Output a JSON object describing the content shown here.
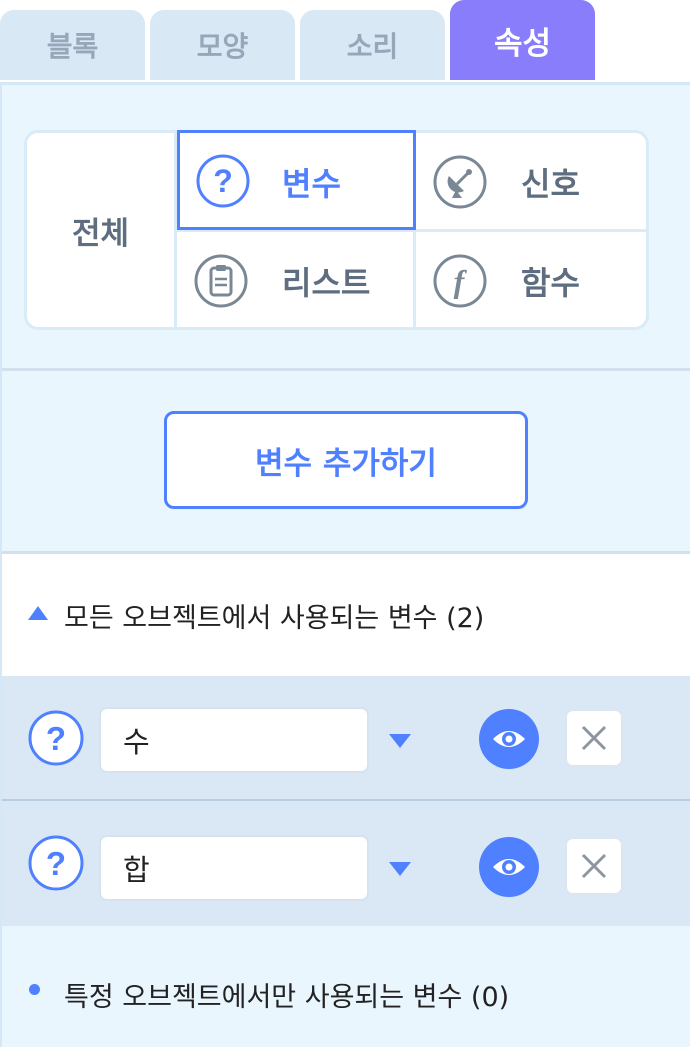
{
  "tabs": [
    {
      "label": "블록",
      "active": false
    },
    {
      "label": "모양",
      "active": false
    },
    {
      "label": "소리",
      "active": false
    },
    {
      "label": "속성",
      "active": true
    }
  ],
  "filter": {
    "all_label": "전체",
    "items": [
      {
        "label": "변수",
        "icon": "question-icon",
        "selected": true
      },
      {
        "label": "신호",
        "icon": "signal-dish-icon",
        "selected": false
      },
      {
        "label": "리스트",
        "icon": "clipboard-list-icon",
        "selected": false
      },
      {
        "label": "함수",
        "icon": "function-icon",
        "selected": false
      }
    ]
  },
  "add_button_label": "변수 추가하기",
  "global_section": {
    "title": "모든 오브젝트에서 사용되는 변수 (2)",
    "variables": [
      {
        "name": "수"
      },
      {
        "name": "합"
      }
    ]
  },
  "local_section": {
    "title": "특정 오브젝트에서만 사용되는 변수 (0)"
  },
  "colors": {
    "accent": "#4f80ff",
    "active_tab": "#8a7dfc",
    "panel_bg": "#eaf6fe",
    "row_bg": "#d9e8f4"
  }
}
